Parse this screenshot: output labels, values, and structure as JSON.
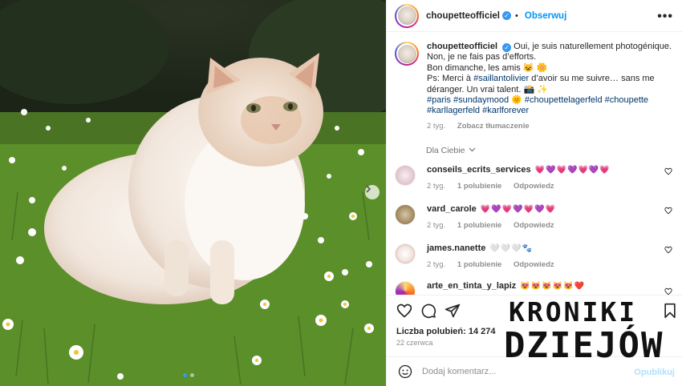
{
  "post": {
    "username": "choupetteofficiel",
    "follow_label": "Obserwuj",
    "more_icon": "more-options-icon",
    "caption": {
      "username": "choupetteofficiel",
      "line1": "Oui, je suis naturellement photogénique.",
      "line2": "Non, je ne fais pas d’efforts.",
      "line3": "Bon dimanche, les amis 😺 🌼",
      "line4_prefix": "Ps: Merci à ",
      "line4_mention": "#saillantolivier",
      "line4_suffix": " d’avoir su me suivre… sans me",
      "line5": "déranger. Un vrai talent. 📸 ✨",
      "hashtags1": "#paris #sundaymood 🌞 #choupettelagerfeld #choupette",
      "hashtags2": "#karllagerfeld #karlforever",
      "time": "2 tyg.",
      "translate_label": "Zobacz tłumaczenie"
    },
    "filter_label": "Dla Ciebie",
    "comments": [
      {
        "user": "conseils_ecrits_services",
        "text": "💗💜💗💜💗💜💗",
        "time": "2 tyg.",
        "likes": "1 polubienie",
        "reply": "Odpowiedz"
      },
      {
        "user": "vard_carole",
        "text": "💗💜💗💜💗💜💗",
        "time": "2 tyg.",
        "likes": "1 polubienie",
        "reply": "Odpowiedz"
      },
      {
        "user": "james.nanette",
        "text": "🤍🤍🤍🐾",
        "time": "2 tyg.",
        "likes": "1 polubienie",
        "reply": "Odpowiedz"
      },
      {
        "user": "arte_en_tinta_y_lapiz",
        "text": "😻😻😻😻😻❤️",
        "time": "",
        "likes": "",
        "reply": ""
      }
    ],
    "likes_label": "Liczba polubień: 14 274",
    "date": "22 czerwca",
    "comment_placeholder": "Dodaj komentarz...",
    "publish_label": "Opublikuj"
  },
  "watermark": {
    "line1": "KRONIKI",
    "line2": "DZIEJÓW"
  },
  "colors": {
    "accent": "#0095f6",
    "verified": "#3897f0",
    "hashtag": "#00376b",
    "muted": "#8e8e8e"
  }
}
